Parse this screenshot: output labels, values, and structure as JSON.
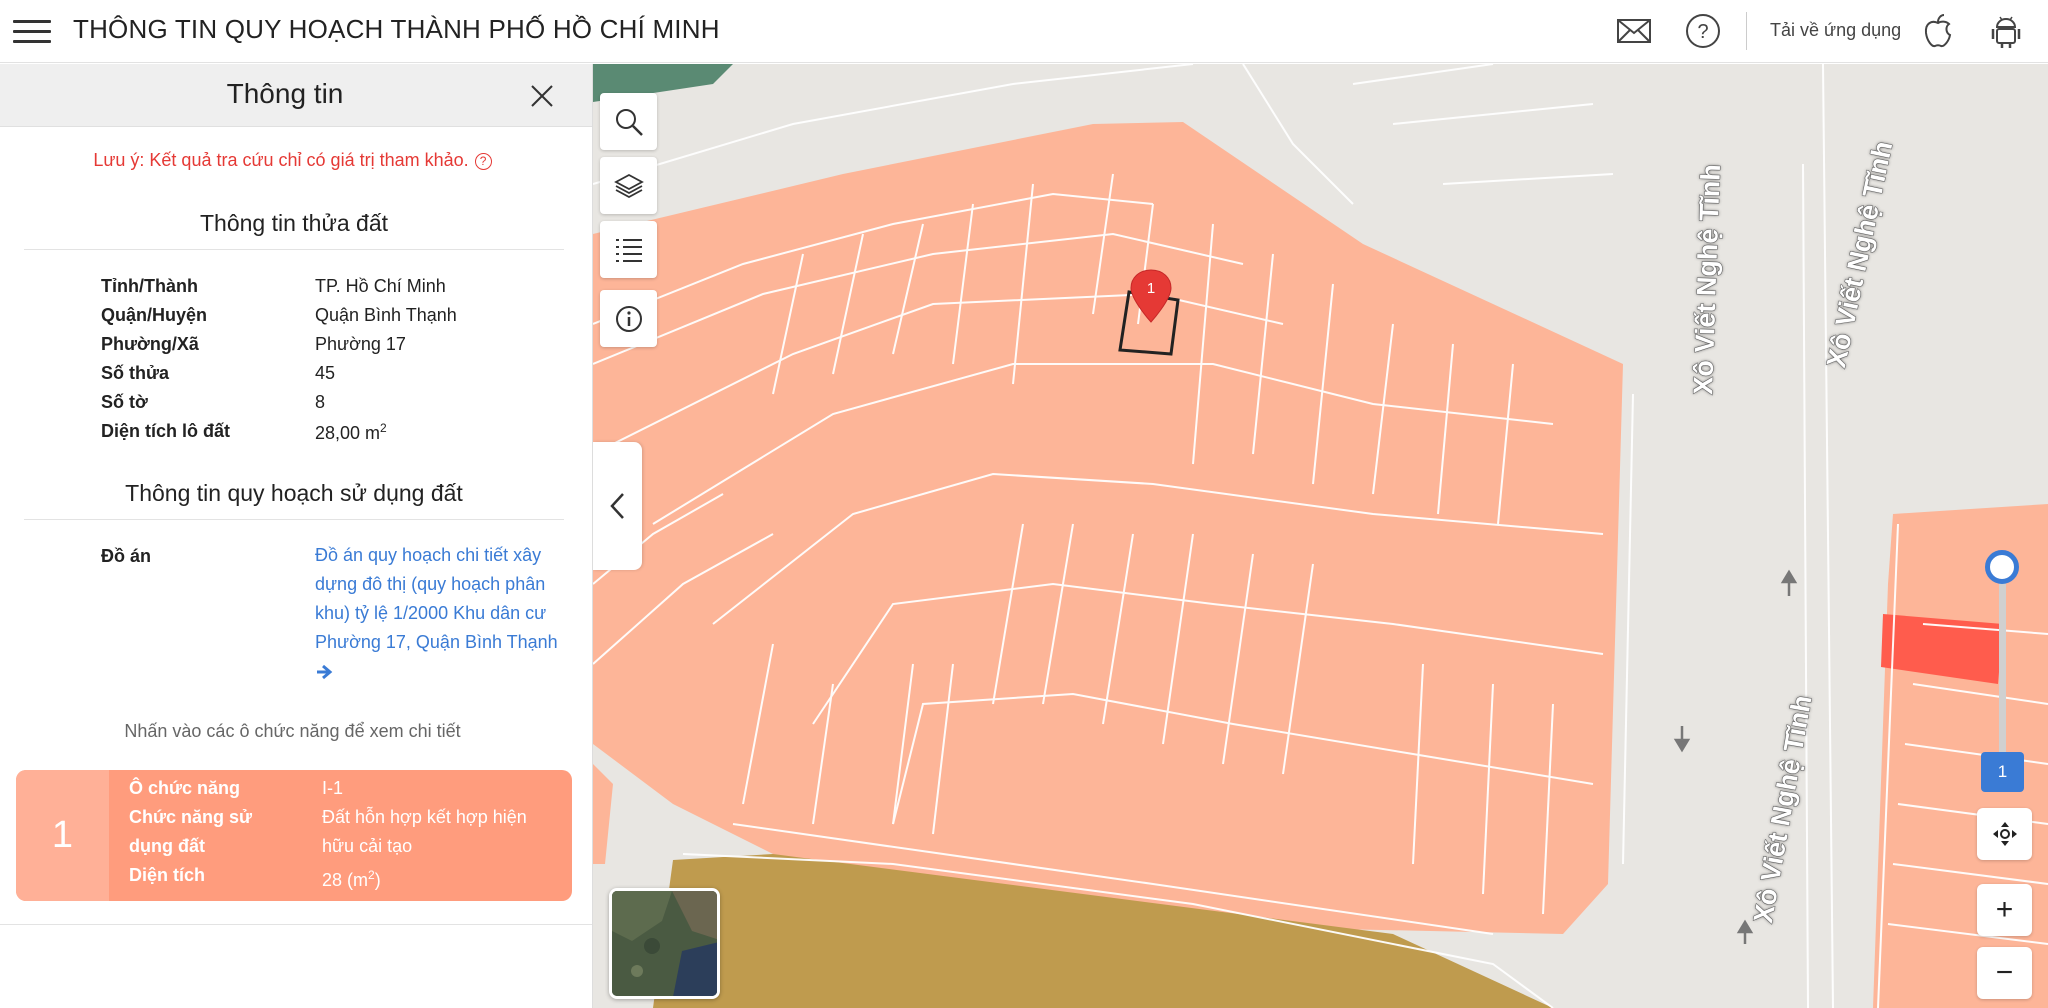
{
  "header": {
    "title": "THÔNG TIN QUY HOẠCH THÀNH PHỐ HỒ CHÍ MINH",
    "download_label": "Tải về ứng dụng"
  },
  "panel": {
    "title": "Thông tin",
    "note": "Lưu ý: Kết quả tra cứu chỉ có giá trị tham khảo.",
    "land_section_title": "Thông tin thửa đất",
    "land_rows": [
      {
        "label": "Tỉnh/Thành",
        "value": "TP. Hồ Chí Minh"
      },
      {
        "label": "Quận/Huyện",
        "value": "Quận Bình Thạnh"
      },
      {
        "label": "Phường/Xã",
        "value": "Phường 17"
      },
      {
        "label": "Số thửa",
        "value": "45"
      },
      {
        "label": "Số tờ",
        "value": "8"
      },
      {
        "label": "Diện tích lô đất",
        "value": "28,00 m",
        "sup": "2"
      }
    ],
    "planning_section_title": "Thông tin quy hoạch sử dụng đất",
    "plan_label": "Đồ án",
    "plan_value": "Đồ án quy hoạch chi tiết xây dựng đô thị (quy hoạch phân khu) tỷ lệ 1/2000 Khu dân cư Phường 17, Quận Bình Thạnh",
    "hint": "Nhấn vào các ô chức năng để xem chi tiết",
    "zone": {
      "number": "1",
      "label_func": "Ô chức năng",
      "value_func": "I-1",
      "label_use_1": "Chức năng sử",
      "label_use_2": "dụng đất",
      "value_use_1": "Đất hỗn hợp kết hợp hiện",
      "value_use_2": "hữu cải tạo",
      "label_area": "Diện tích",
      "value_area": "28 (m",
      "value_area_sup": "2",
      "value_area_close": ")"
    }
  },
  "map": {
    "marker_label": "1",
    "street_name": "Xô Viết Nghệ Tĩnh",
    "layer_slider_value": "1",
    "zoom_in": "+",
    "zoom_out": "−",
    "colors": {
      "zone_residential": "#fdb598",
      "zone_highlight": "#ff5c4d",
      "zone_green": "#5a8a73",
      "zone_other": "#bf9b4e",
      "road": "#e8e6e2",
      "accent": "#3a7bd5",
      "marker": "#e53935"
    }
  }
}
